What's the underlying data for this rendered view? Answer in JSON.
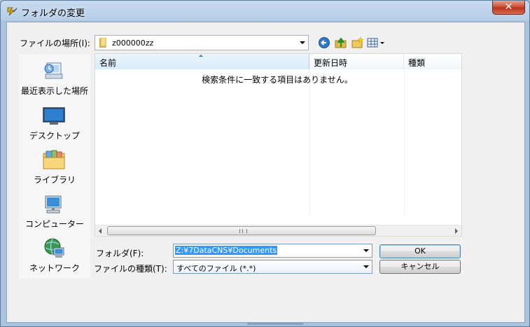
{
  "window": {
    "title": "フォルダの変更",
    "close_label": "✕"
  },
  "lookin": {
    "label": "ファイルの場所(I):",
    "value": "z000000zz"
  },
  "toolbar": {
    "back": "back-icon",
    "up": "up-folder-icon",
    "newfolder": "new-folder-icon",
    "view": "view-menu-icon"
  },
  "places": [
    {
      "label": "最近表示した場所",
      "icon": "recent-places-icon"
    },
    {
      "label": "デスクトップ",
      "icon": "desktop-icon"
    },
    {
      "label": "ライブラリ",
      "icon": "libraries-icon"
    },
    {
      "label": "コンピューター",
      "icon": "computer-icon"
    },
    {
      "label": "ネットワーク",
      "icon": "network-icon"
    }
  ],
  "filelist": {
    "columns": [
      "名前",
      "更新日時",
      "種類"
    ],
    "empty_message": "検索条件に一致する項目はありません。",
    "scroll_grip": "III"
  },
  "folder_field": {
    "label": "フォルダ(F):",
    "value": "Z:¥7DataCNS¥Documents"
  },
  "type_field": {
    "label": "ファイルの種類(T):",
    "value": "すべてのファイル (*.*)"
  },
  "buttons": {
    "ok": "OK",
    "cancel": "キャンセル"
  }
}
